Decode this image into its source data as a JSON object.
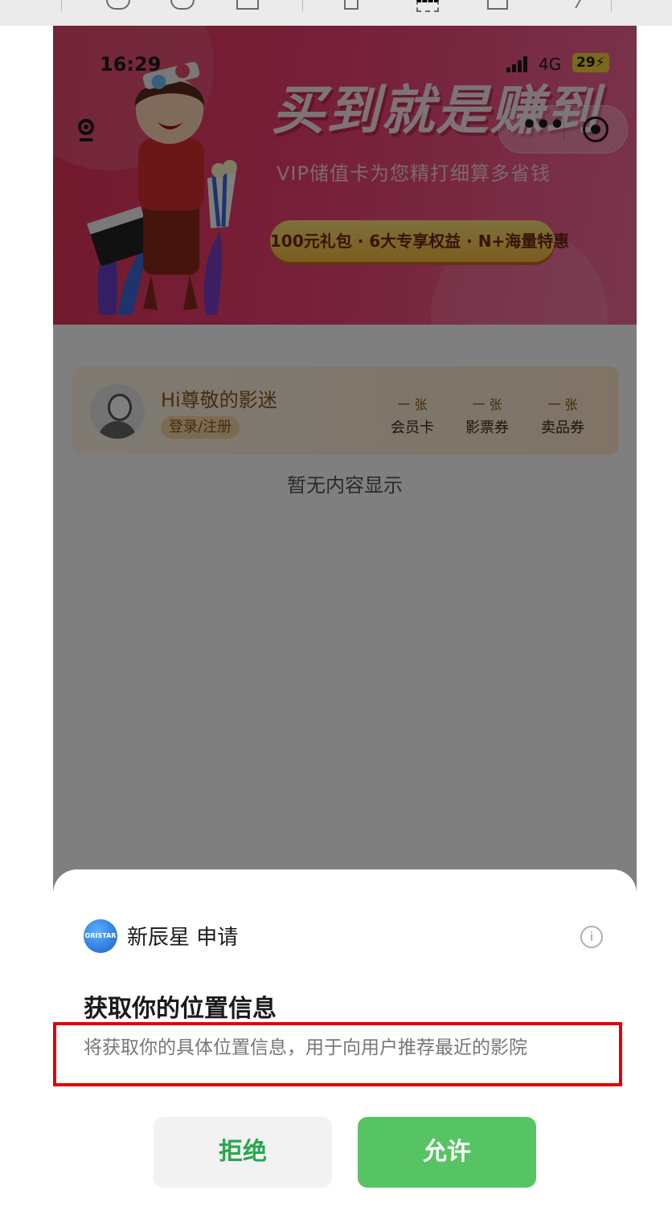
{
  "status_bar": {
    "time": "16:29",
    "network": "4G",
    "battery": "29⚡"
  },
  "banner": {
    "headline": "买到就是赚到",
    "subline": "VIP储值卡为您精打细算多省钱",
    "pill": "100元礼包 · 6大专享权益 · N+海量特惠"
  },
  "member": {
    "greeting": "Hi尊敬的影迷",
    "login": "登录/注册",
    "stats": [
      {
        "num": "一 张",
        "label": "会员卡"
      },
      {
        "num": "一 张",
        "label": "影票券"
      },
      {
        "num": "一 张",
        "label": "卖品券"
      }
    ]
  },
  "empty_text": "暂无内容显示",
  "dialog": {
    "logo_text": "ORISTAR",
    "app_name": "新辰星 申请",
    "title": "获取你的位置信息",
    "description": "将获取你的具体位置信息，用于向用户推荐最近的影院",
    "deny": "拒绝",
    "allow": "允许"
  }
}
